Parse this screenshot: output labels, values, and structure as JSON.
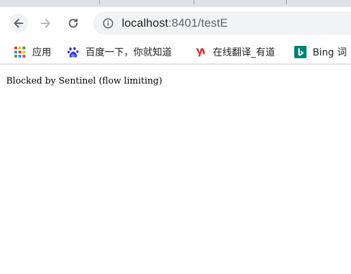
{
  "browser": {
    "address_bar": {
      "host": "localhost",
      "path": ":8401/testE"
    },
    "bookmarks": [
      {
        "label": "应用",
        "icon": "apps-grid-icon"
      },
      {
        "label": "百度一下，你就知道",
        "icon": "baidu-paw-icon"
      },
      {
        "label": "在线翻译_有道",
        "icon": "youdao-icon"
      },
      {
        "label": "Bing 词",
        "icon": "bing-icon"
      }
    ],
    "colors": {
      "toolbar_bg": "#ffffff",
      "omnibox_bg": "#f1f3f4",
      "tabstrip_bg": "#dee1e6",
      "baidu_blue": "#2932e1",
      "youdao_red": "#e3242b",
      "bing_teal": "#008373"
    }
  },
  "page": {
    "message": "Blocked by Sentinel (flow limiting)"
  }
}
